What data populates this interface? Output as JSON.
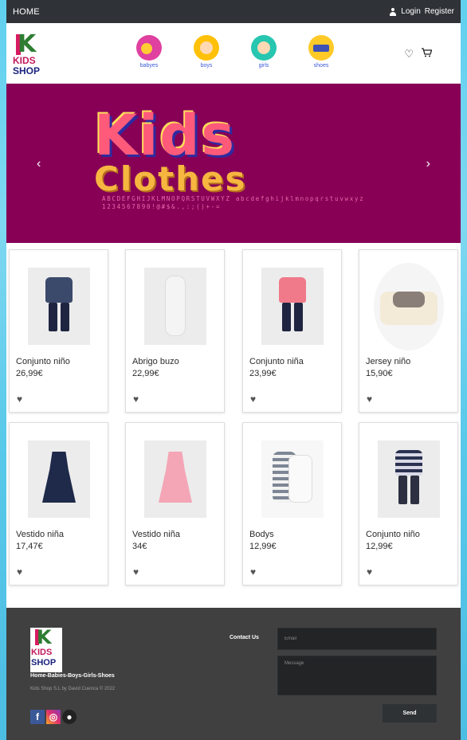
{
  "topbar": {
    "home": "HOME",
    "login": "Login",
    "register": "Register",
    "user_icon": "user-icon"
  },
  "brand": {
    "logo_letter": "K",
    "logo_line1": "KIDS",
    "logo_line2": "SHOP"
  },
  "categories": [
    {
      "label": "babyes"
    },
    {
      "label": "boys"
    },
    {
      "label": "girls"
    },
    {
      "label": "shoes"
    }
  ],
  "nav_icons": {
    "wishlist": "heart-icon",
    "cart": "cart-icon"
  },
  "banner": {
    "line1": "Kids",
    "line2": "Clothes",
    "alphabet": "ABCDEFGHIJKLMNOPQRSTUVWXYZ abcdefghijklmnopqrstuvwxyz 1234567890!@#$&.,:;()+-=",
    "prev": "‹",
    "next": "›"
  },
  "products": [
    {
      "name": "Conjunto niño",
      "price": "26,99€"
    },
    {
      "name": "Abrigo buzo",
      "price": "22,99€"
    },
    {
      "name": "Conjunto niña",
      "price": "23,99€"
    },
    {
      "name": "Jersey niño",
      "price": "15,90€"
    },
    {
      "name": "Vestido niña",
      "price": "17,47€"
    },
    {
      "name": "Vestido niña",
      "price": "34€"
    },
    {
      "name": "Bodys",
      "price": "12,99€"
    },
    {
      "name": "Conjunto niño",
      "price": "12,99€"
    }
  ],
  "footer": {
    "links": "Home-Babies-Boys-Girls-Shoes",
    "copyright": "Kids Shop S.L by David Cuenca © 2022",
    "contact_label": "Contact Us",
    "email_placeholder": "Email",
    "message_placeholder": "Message",
    "send": "Send",
    "social": [
      "facebook-icon",
      "instagram-icon",
      "github-icon"
    ]
  },
  "colors": {
    "topbar": "#2f3338",
    "banner": "#870056",
    "footer": "#404040",
    "category_link": "#3b5bd6"
  }
}
